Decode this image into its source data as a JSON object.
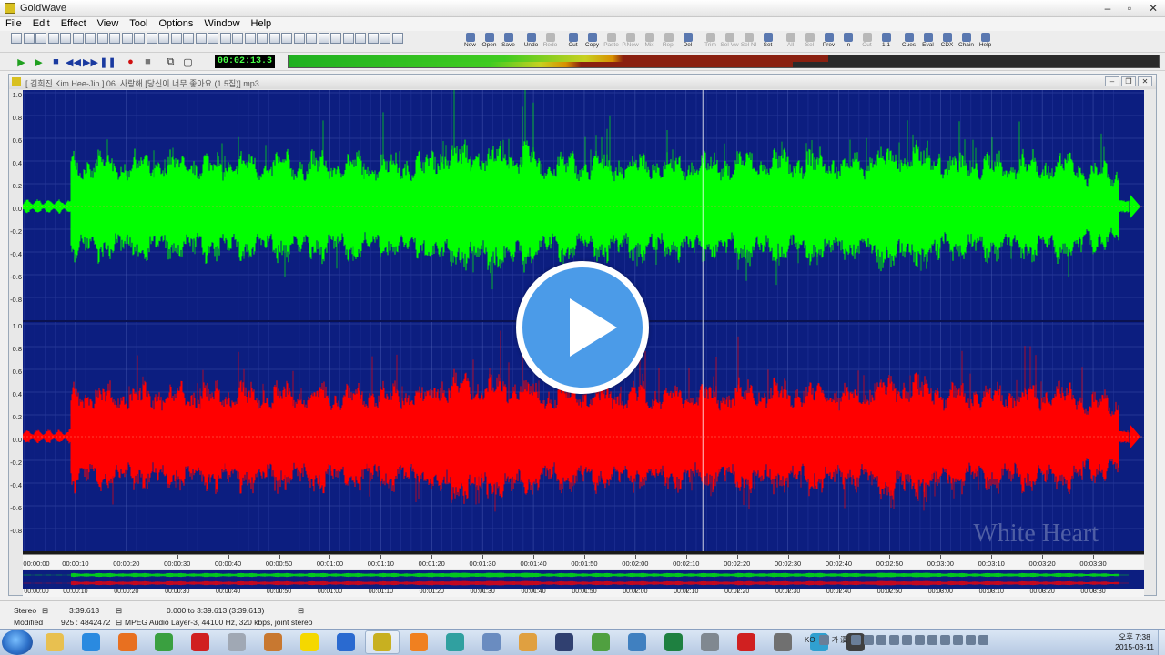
{
  "window": {
    "title": "GoldWave"
  },
  "menu": [
    "File",
    "Edit",
    "Effect",
    "View",
    "Tool",
    "Options",
    "Window",
    "Help"
  ],
  "toolbar": {
    "named_tools": [
      {
        "label": "New",
        "icon": "new-file-icon",
        "enabled": true
      },
      {
        "label": "Open",
        "icon": "open-folder-icon",
        "enabled": true
      },
      {
        "label": "Save",
        "icon": "save-disk-icon",
        "enabled": true
      },
      {
        "label": "Undo",
        "icon": "undo-icon",
        "enabled": true
      },
      {
        "label": "Redo",
        "icon": "redo-icon",
        "enabled": false
      },
      {
        "label": "Cut",
        "icon": "scissors-icon",
        "enabled": true
      },
      {
        "label": "Copy",
        "icon": "copy-icon",
        "enabled": true
      },
      {
        "label": "Paste",
        "icon": "paste-icon",
        "enabled": false
      },
      {
        "label": "P.New",
        "icon": "paste-new-icon",
        "enabled": false
      },
      {
        "label": "Mix",
        "icon": "mix-icon",
        "enabled": false
      },
      {
        "label": "Repl",
        "icon": "replace-icon",
        "enabled": false
      },
      {
        "label": "Del",
        "icon": "delete-icon",
        "enabled": true
      },
      {
        "label": "Trim",
        "icon": "trim-icon",
        "enabled": false
      },
      {
        "label": "Sel Vw",
        "icon": "select-view-icon",
        "enabled": false
      },
      {
        "label": "Sel Nl",
        "icon": "select-all-icon",
        "enabled": false
      },
      {
        "label": "Set",
        "icon": "set-marker-icon",
        "enabled": true
      },
      {
        "label": "All",
        "icon": "zoom-all-icon",
        "enabled": false
      },
      {
        "label": "Sel",
        "icon": "zoom-selection-icon",
        "enabled": false
      },
      {
        "label": "Prev",
        "icon": "zoom-previous-icon",
        "enabled": true
      },
      {
        "label": "In",
        "icon": "zoom-in-icon",
        "enabled": true
      },
      {
        "label": "Out",
        "icon": "zoom-out-icon",
        "enabled": false
      },
      {
        "label": "1:1",
        "icon": "zoom-actual-icon",
        "enabled": true
      },
      {
        "label": "Cues",
        "icon": "cue-points-icon",
        "enabled": true
      },
      {
        "label": "Eval",
        "icon": "expression-evaluator-icon",
        "enabled": true
      },
      {
        "label": "CDX",
        "icon": "cd-extract-icon",
        "enabled": true
      },
      {
        "label": "Chain",
        "icon": "chain-icon",
        "enabled": true
      },
      {
        "label": "Help",
        "icon": "help-book-icon",
        "enabled": true
      }
    ]
  },
  "transport": {
    "time": "00:02:13.3",
    "buttons": [
      {
        "name": "play-all-button",
        "glyph": "▶"
      },
      {
        "name": "play-selection-button",
        "glyph": "▶"
      },
      {
        "name": "stop-button",
        "glyph": "■"
      },
      {
        "name": "rewind-button",
        "glyph": "◀◀"
      },
      {
        "name": "fast-forward-button",
        "glyph": "▶▶"
      },
      {
        "name": "pause-button",
        "glyph": "❚❚"
      },
      {
        "name": "record-button",
        "glyph": "●"
      },
      {
        "name": "record-stop-button",
        "glyph": "■"
      },
      {
        "name": "loop-button",
        "glyph": "⧉"
      },
      {
        "name": "monitor-button",
        "glyph": "▢"
      }
    ],
    "level_left": 0.62,
    "level_right": 0.58
  },
  "document": {
    "title": "[ 김희진 Kim Hee-Jin ] 06. 사랑해 [당신이 너무 좋아요 (1.5집)].mp3",
    "scale_labels": [
      "1.0",
      "0.8",
      "0.6",
      "0.4",
      "0.2",
      "0.0",
      "-0.2",
      "-0.4",
      "-0.6",
      "-0.8"
    ],
    "time_labels": [
      "00:00:00",
      "00:00:10",
      "00:00:20",
      "00:00:30",
      "00:00:40",
      "00:00:50",
      "00:01:00",
      "00:01:10",
      "00:01:20",
      "00:01:30",
      "00:01:40",
      "00:01:50",
      "00:02:00",
      "00:02:10",
      "00:02:20",
      "00:02:30",
      "00:02:40",
      "00:02:50",
      "00:03:00",
      "00:03:10",
      "00:03:20",
      "00:03:30"
    ],
    "duration_seconds": 219.613,
    "playhead_seconds": 133.3,
    "watermark": "White Heart",
    "left_channel_color": "#00ff00",
    "right_channel_color": "#ff0000",
    "background_color": "#0c1e80"
  },
  "status": {
    "channels": "Stereo",
    "length": "3:39.613",
    "selection": "0.000 to 3:39.613 (3:39.613)",
    "state": "Modified",
    "position": "925 : 4842472",
    "format": "MPEG Audio Layer-3, 44100 Hz, 320 kbps, joint stereo"
  },
  "taskbar": {
    "apps": [
      {
        "name": "taskbar-file-explorer",
        "color": "#e8c050"
      },
      {
        "name": "taskbar-internet-explorer",
        "color": "#2a8ae0"
      },
      {
        "name": "taskbar-firefox",
        "color": "#e87020"
      },
      {
        "name": "taskbar-chrome",
        "color": "#3aa040"
      },
      {
        "name": "taskbar-opera",
        "color": "#d02020"
      },
      {
        "name": "taskbar-app-gray",
        "color": "#a0a8b4"
      },
      {
        "name": "taskbar-app-tiger",
        "color": "#c87830"
      },
      {
        "name": "taskbar-kakaotalk",
        "color": "#f5d800"
      },
      {
        "name": "taskbar-app-m",
        "color": "#2a6ad0"
      },
      {
        "name": "taskbar-goldwave",
        "color": "#c8b020",
        "active": true
      },
      {
        "name": "taskbar-app-orange",
        "color": "#f08020"
      },
      {
        "name": "taskbar-app-teal",
        "color": "#30a0a0"
      },
      {
        "name": "taskbar-app-pen",
        "color": "#6a8cc0"
      },
      {
        "name": "taskbar-app-palette",
        "color": "#e0a040"
      },
      {
        "name": "taskbar-app-video",
        "color": "#304070"
      },
      {
        "name": "taskbar-app-leaf",
        "color": "#50a040"
      },
      {
        "name": "taskbar-app-disk",
        "color": "#4080c0"
      },
      {
        "name": "taskbar-excel",
        "color": "#1e8040"
      },
      {
        "name": "taskbar-app-gear-doc",
        "color": "#808890"
      },
      {
        "name": "taskbar-media-player",
        "color": "#d02020"
      },
      {
        "name": "taskbar-app-settings",
        "color": "#707070"
      },
      {
        "name": "taskbar-app-window",
        "color": "#30a0d0"
      },
      {
        "name": "taskbar-app-dark",
        "color": "#404040"
      }
    ],
    "lang": "KO",
    "tray_text": "가 漢",
    "clock_time": "오후 7:38",
    "clock_date": "2015-03-11"
  }
}
